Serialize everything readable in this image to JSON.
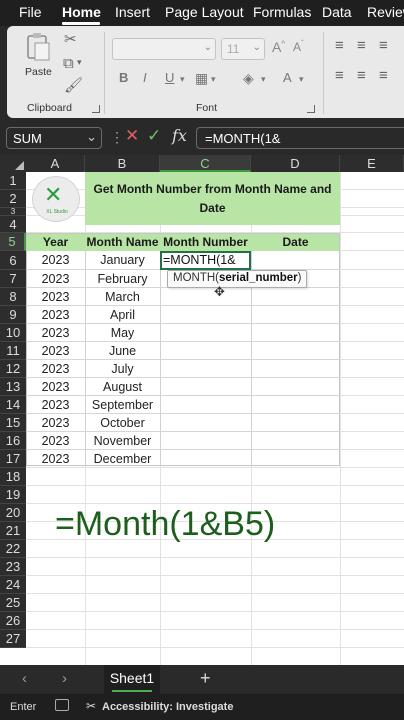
{
  "menu": {
    "items": [
      "File",
      "Home",
      "Insert",
      "Page Layout",
      "Formulas",
      "Data",
      "Review"
    ],
    "active": "Home"
  },
  "ribbon": {
    "clipboard_label": "Clipboard",
    "paste_label": "Paste",
    "font_label": "Font",
    "font_size": "11",
    "bold": "B",
    "italic": "I",
    "underline": "U"
  },
  "formula_bar": {
    "name_box": "SUM",
    "fx": "fx",
    "content": "=MONTH(1&"
  },
  "columns": [
    "A",
    "B",
    "C",
    "D",
    "E"
  ],
  "rows": [
    "1",
    "2",
    "3",
    "4",
    "5",
    "6",
    "7",
    "8",
    "9",
    "10",
    "11",
    "12",
    "13",
    "14",
    "15",
    "16",
    "17",
    "18",
    "19",
    "20",
    "21",
    "22",
    "23",
    "24",
    "25",
    "26",
    "27"
  ],
  "sheet": {
    "title": "Get Month Number from Month Name and Date",
    "logo_text": "XL Studio",
    "headers": [
      "Year",
      "Month Name",
      "Month Number",
      "Date"
    ],
    "data": [
      [
        "2023",
        "January"
      ],
      [
        "2023",
        "February"
      ],
      [
        "2023",
        "March"
      ],
      [
        "2023",
        "April"
      ],
      [
        "2023",
        "May"
      ],
      [
        "2023",
        "June"
      ],
      [
        "2023",
        "July"
      ],
      [
        "2023",
        "August"
      ],
      [
        "2023",
        "September"
      ],
      [
        "2023",
        "October"
      ],
      [
        "2023",
        "November"
      ],
      [
        "2023",
        "December"
      ]
    ],
    "active_cell_text": "=MONTH(1&",
    "tooltip_fn": "MONTH(",
    "tooltip_arg": "serial_number",
    "tooltip_end": ")",
    "overlay_formula": "=Month(1&B5)"
  },
  "tabs": {
    "sheet_name": "Sheet1",
    "add": "+"
  },
  "status": {
    "mode": "Enter",
    "accessibility": "Accessibility: Investigate"
  },
  "colors": {
    "accent_green": "#217346",
    "header_fill": "#b8e4a6",
    "dark_chrome": "#292929"
  }
}
